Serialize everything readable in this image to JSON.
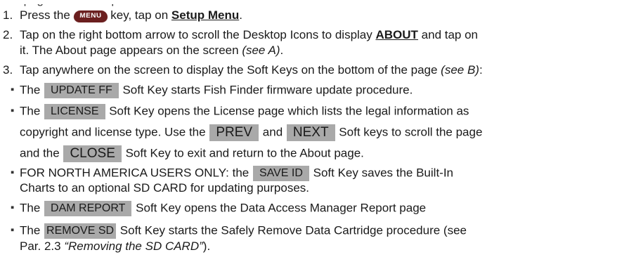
{
  "top_partial": "on page of the Setup Menu",
  "items": {
    "n1": "1.",
    "n2": "2.",
    "n3": "3.",
    "s1_a": "Press the ",
    "menu_key": "MENU",
    "s1_b": " key, tap on ",
    "s1_link": "Setup Menu",
    "s1_c": ".",
    "s2_a": "Tap on the right bottom arrow to scroll the Desktop Icons to display ",
    "s2_link": "ABOUT",
    "s2_b": " and tap on",
    "s2_c": "it. The About page appears on the screen ",
    "s2_see": "(see A)",
    "s2_d": ".",
    "s3_a": "Tap anywhere on the screen to display the Soft Keys on the bottom of the page ",
    "s3_see": "(see B)",
    "s3_b": ":",
    "bullet": "▪",
    "b1_a": "The ",
    "key_update": "UPDATE FF",
    "b1_b": " Soft Key starts Fish Finder firmware update procedure.",
    "b2_a": "The ",
    "key_license": "LICENSE",
    "b2_b": " Soft Key opens the License page which lists the legal information as",
    "b2_c": "copyright and license type. Use the ",
    "key_prev": "PREV",
    "b2_d": " and ",
    "key_next": "NEXT",
    "b2_e": " Soft keys to scroll the page",
    "b2_f": "and the ",
    "key_close": "CLOSE",
    "b2_g": " Soft Key to exit and return to the About page.",
    "b3_a": "FOR NORTH AMERICA USERS ONLY: the ",
    "key_saveid": "SAVE ID",
    "b3_b": " Soft Key saves the Built-In",
    "b3_c": "Charts to an optional SD CARD for updating purposes.",
    "b4_a": "The ",
    "key_dam": "DAM REPORT",
    "b4_b": " Soft Key opens the Data Access Manager Report page",
    "b5_a": "The ",
    "key_remove": "REMOVE SD",
    "b5_b": " Soft Key starts the Safely Remove Data Cartridge procedure (see",
    "b5_c": "Par. 2.3 ",
    "b5_ref": "“Removing the SD CARD”",
    "b5_d": ")."
  }
}
